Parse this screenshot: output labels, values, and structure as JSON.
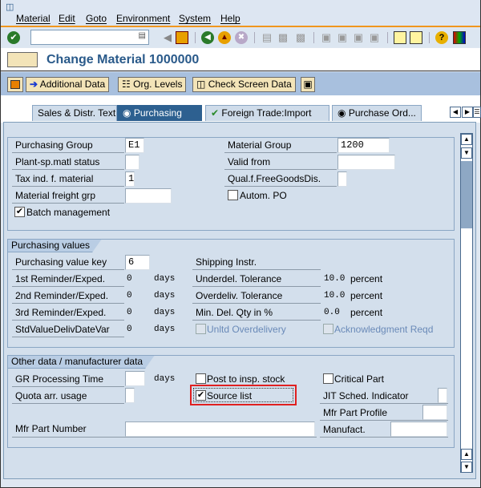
{
  "menu": [
    "Material",
    "Edit",
    "Goto",
    "Environment",
    "System",
    "Help"
  ],
  "toolbar": {
    "command_value": "",
    "icons": [
      "enter-icon",
      "save-icon",
      "back-icon",
      "exit-icon",
      "cancel-icon",
      "print-icon",
      "find-icon",
      "find-next-icon",
      "first-page-icon",
      "prev-page-icon",
      "next-page-icon",
      "last-page-icon",
      "new-session-icon",
      "shortcut-icon",
      "help-icon",
      "customize-layout-icon"
    ]
  },
  "title": "Change Material 1000000",
  "app_toolbar": {
    "additional_data": "Additional Data",
    "org_levels": "Org. Levels",
    "check_screen_data": "Check Screen Data"
  },
  "tabs": [
    {
      "label": "Sales & Distr. Text"
    },
    {
      "label": "Purchasing",
      "active": true
    },
    {
      "label": "Foreign Trade:Import"
    },
    {
      "label": "Purchase Ord..."
    }
  ],
  "general": {
    "purchasing_group": {
      "label": "Purchasing Group",
      "value": "E1"
    },
    "plant_status": {
      "label": "Plant-sp.matl status",
      "value": ""
    },
    "tax_ind": {
      "label": "Tax ind. f. material",
      "value": "1"
    },
    "freight_grp": {
      "label": "Material freight grp",
      "value": ""
    },
    "batch_mgmt": {
      "label": "Batch management",
      "checked": true
    },
    "material_group": {
      "label": "Material Group",
      "value": "1200"
    },
    "valid_from": {
      "label": "Valid from",
      "value": ""
    },
    "qual_free_goods": {
      "label": "Qual.f.FreeGoodsDis.",
      "value": ""
    },
    "autom_po": {
      "label": "Autom. PO",
      "checked": false
    }
  },
  "purchasing_values": {
    "title": "Purchasing values",
    "value_key": {
      "label": "Purchasing value key",
      "value": "6"
    },
    "reminders": [
      {
        "label": "1st Reminder/Exped.",
        "value": "0",
        "unit": "days"
      },
      {
        "label": "2nd Reminder/Exped.",
        "value": "0",
        "unit": "days"
      },
      {
        "label": "3rd Reminder/Exped.",
        "value": "0",
        "unit": "days"
      },
      {
        "label": "StdValueDelivDateVar",
        "value": "0",
        "unit": "days"
      }
    ],
    "shipping_instr": {
      "label": "Shipping Instr."
    },
    "tolerances": [
      {
        "label": "Underdel. Tolerance",
        "value": "10.0",
        "unit": "percent"
      },
      {
        "label": "Overdeliv. Tolerance",
        "value": "10.0",
        "unit": "percent"
      },
      {
        "label": "Min. Del. Qty in %",
        "value": "0.0",
        "unit": "percent"
      }
    ],
    "unltd_overdelivery": {
      "label": "Unltd Overdelivery",
      "checked": false
    },
    "ack_reqd": {
      "label": "Acknowledgment Reqd",
      "checked": false
    }
  },
  "other_data": {
    "title": "Other data / manufacturer data",
    "gr_time": {
      "label": "GR Processing Time",
      "value": "",
      "unit": "days"
    },
    "quota": {
      "label": "Quota arr. usage",
      "value": ""
    },
    "post_insp": {
      "label": "Post to insp. stock",
      "checked": false
    },
    "source_list": {
      "label": "Source list",
      "checked": true
    },
    "critical_part": {
      "label": "Critical Part",
      "checked": false
    },
    "jit": {
      "label": "JIT Sched. Indicator",
      "value": ""
    },
    "mfr_profile": {
      "label": "Mfr Part Profile",
      "value": ""
    },
    "mfr_part_number": {
      "label": "Mfr Part Number",
      "value": ""
    },
    "manufact": {
      "label": "Manufact.",
      "value": ""
    }
  },
  "highlight_color": "#e02020"
}
